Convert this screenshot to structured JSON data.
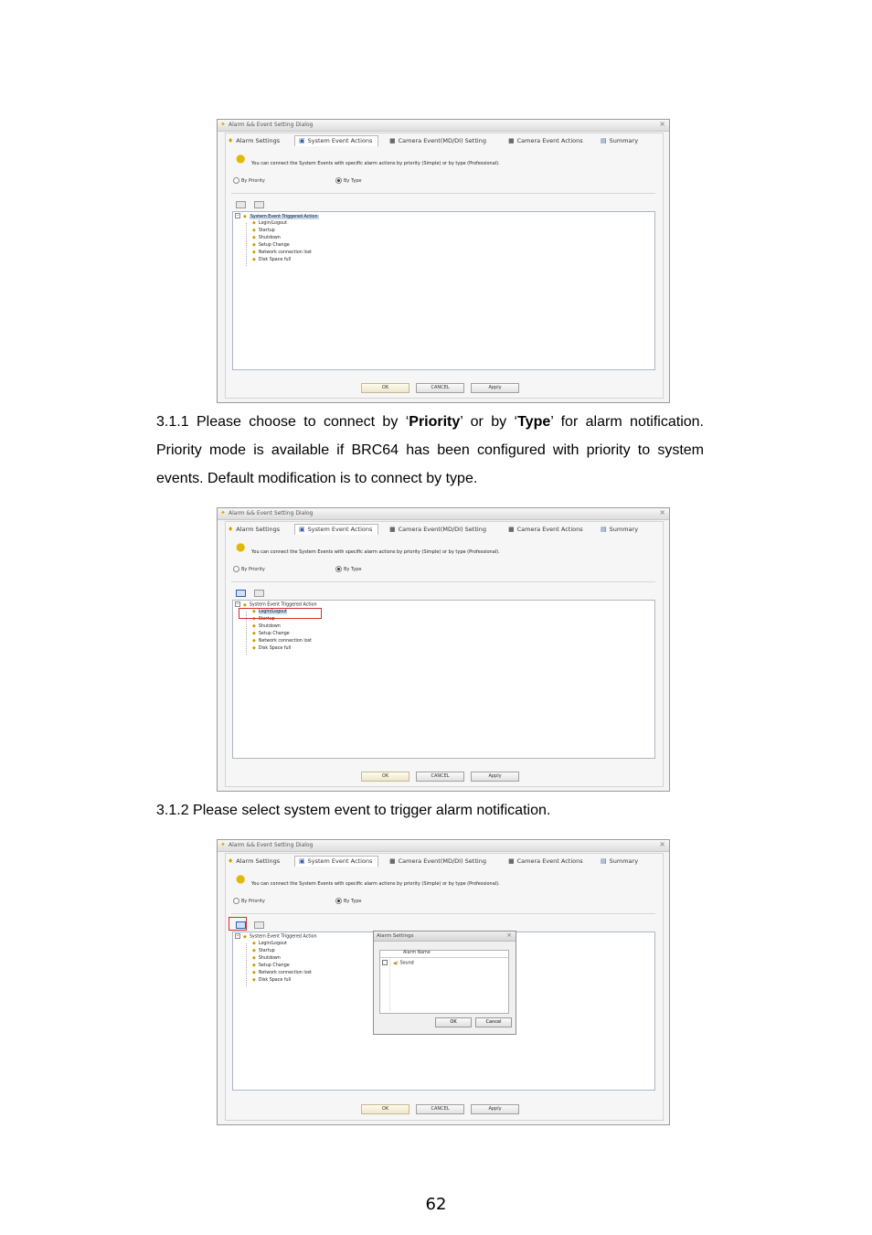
{
  "dialog": {
    "title": "Alarm && Event Setting Dialog",
    "close_glyph": "×",
    "tabs": [
      {
        "label": "Alarm Settings",
        "icon": "bulb-icon"
      },
      {
        "label": "System Event Actions",
        "icon": "monitor-icon"
      },
      {
        "label": "Camera Event(MD/DI) Setting",
        "icon": "camera-icon"
      },
      {
        "label": "Camera Event Actions",
        "icon": "camera-action-icon"
      },
      {
        "label": "Summary",
        "icon": "summary-icon"
      }
    ],
    "hint": "You can connect the System Events with specific alarm actions by priority (Simple) or by type (Professional).",
    "radio_priority": "By Priority",
    "radio_type": "By Type",
    "tree_root": "System Event Triggered Action",
    "tree_items": [
      "Login/Logout",
      "Startup",
      "Shutdown",
      "Setup Change",
      "Network connection lost",
      "Disk Space full"
    ],
    "ok_label": "OK",
    "cancel_label": "CANCEL",
    "apply_label": "Apply"
  },
  "popup": {
    "title": "Alarm Settings",
    "close_glyph": "×",
    "column_header": "Alarm Name",
    "row_label": "Sound",
    "ok_label": "OK",
    "cancel_label": "Cancel"
  },
  "text": {
    "p1_prefix": "3.1.1  Please  choose  to  connect  by  ‘",
    "p1_priority": "Priority",
    "p1_mid": "’  or  by  ‘",
    "p1_type": "Type",
    "p1_suffix": "’  for  alarm notification. Priority mode is available if BRC64 has been configured with priority to system events. Default modification is to connect by type.",
    "p2": "3.1.2    Please select system event to trigger alarm notification."
  },
  "page_number": "62"
}
